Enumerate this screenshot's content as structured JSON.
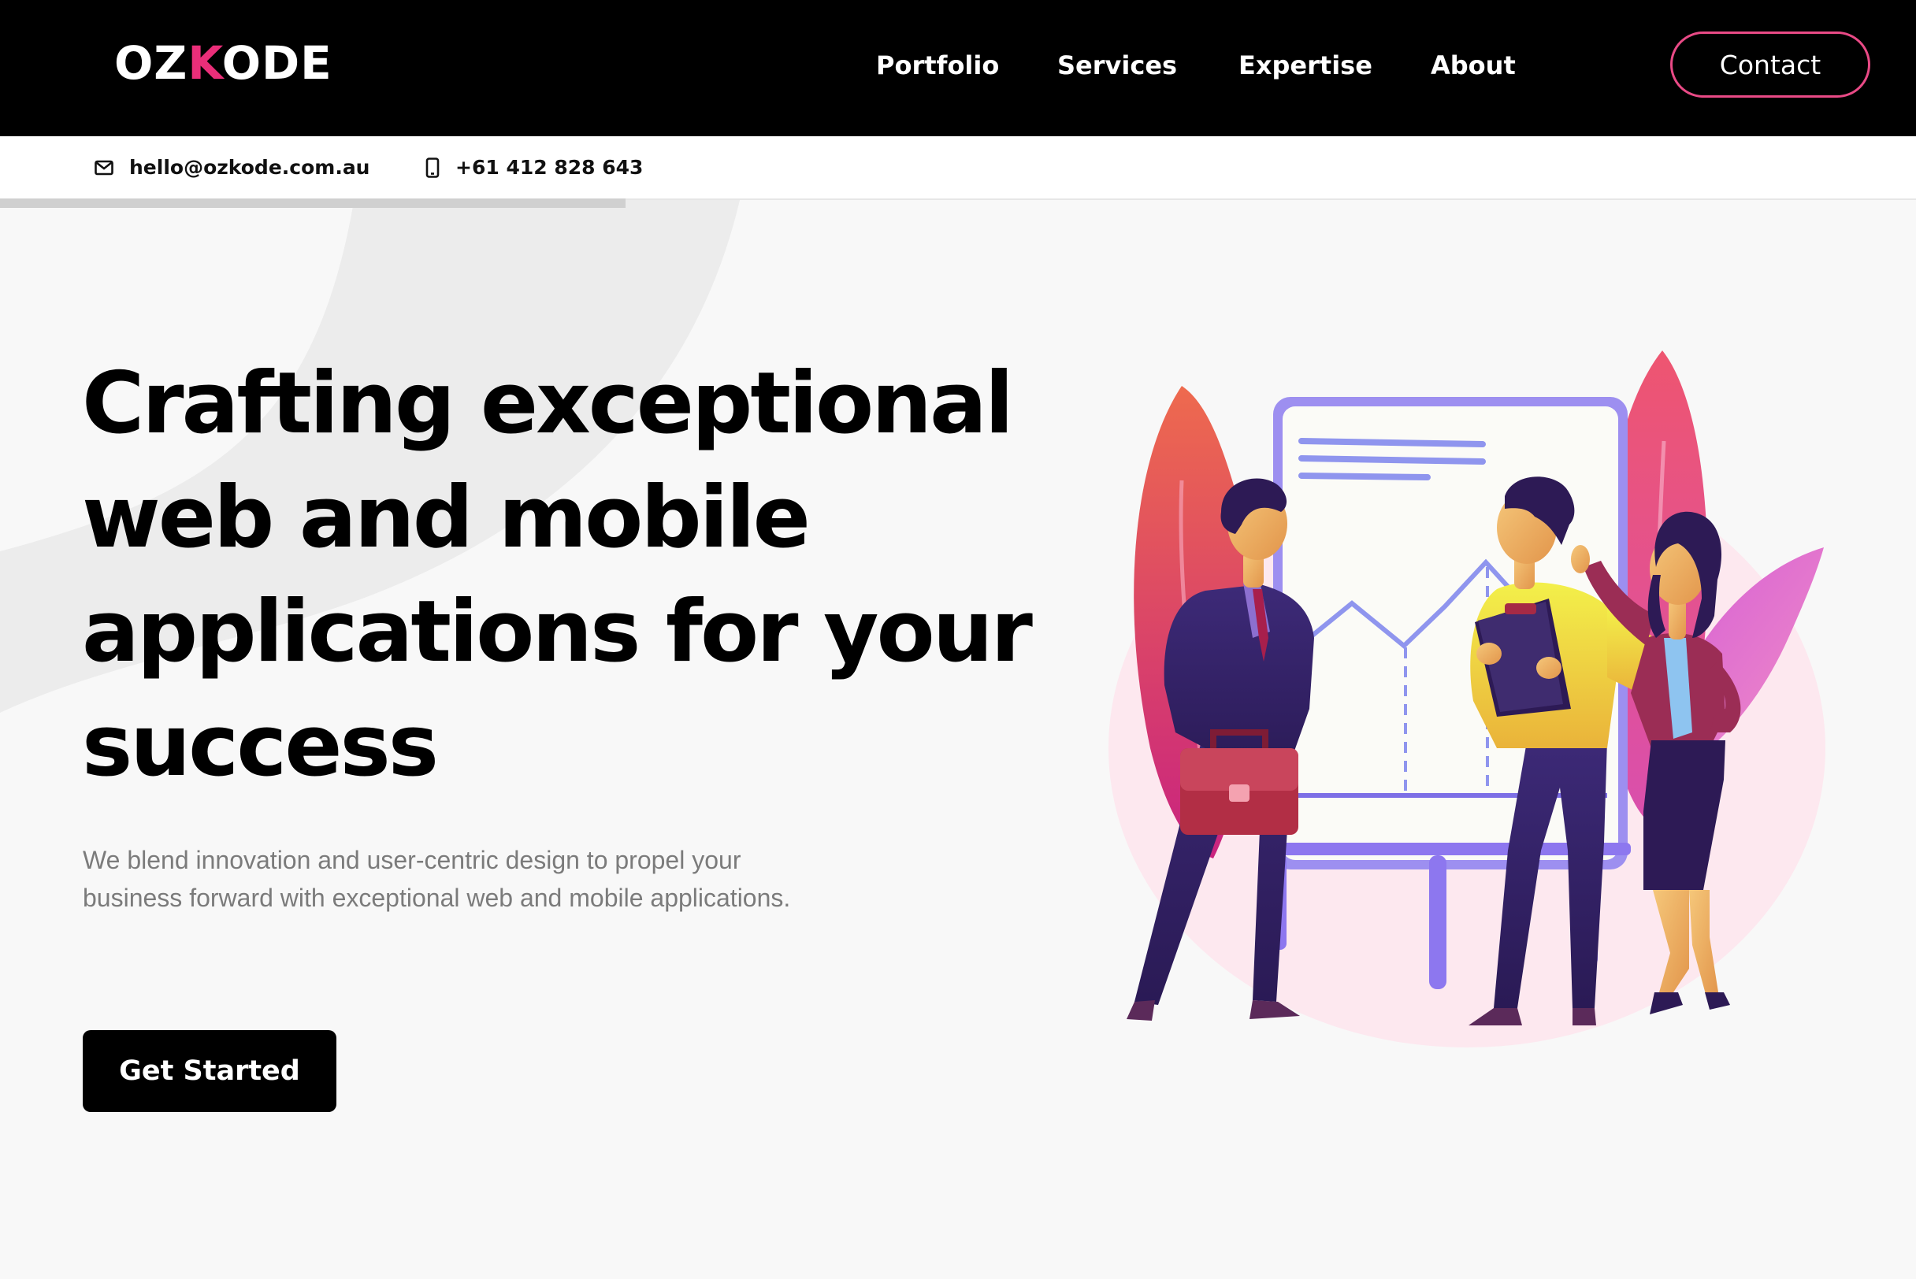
{
  "header": {
    "logo": {
      "prefix": "OZ",
      "accent": "K",
      "suffix": "ODE"
    },
    "nav": [
      "Portfolio",
      "Services",
      "Expertise",
      "About"
    ],
    "contact_label": "Contact"
  },
  "contact_bar": {
    "email": "hello@ozkode.com.au",
    "phone": "+61 412 828 643",
    "email_icon": "envelope-icon",
    "phone_icon": "mobile-phone-icon"
  },
  "hero": {
    "title": "Crafting exceptional web and mobile applications for your success",
    "description": "We blend innovation and user-centric design to propel your business forward with exceptional web and mobile applications.",
    "cta_label": "Get Started"
  },
  "colors": {
    "brand_accent": "#ea2e79",
    "header_bg": "#000000",
    "button_bg": "#000000",
    "page_bg": "#f8f8f8"
  }
}
